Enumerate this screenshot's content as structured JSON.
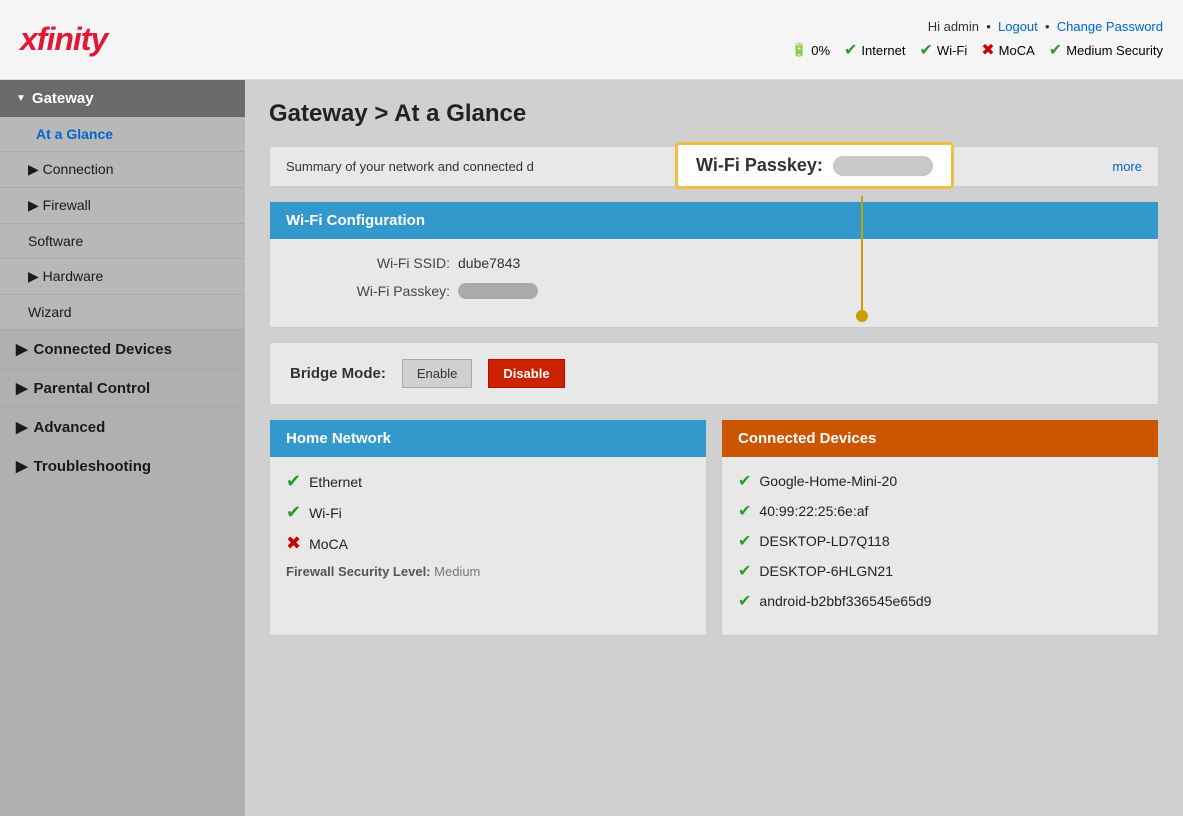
{
  "header": {
    "logo": "xfinity",
    "user_greeting": "Hi admin",
    "logout_label": "Logout",
    "change_password_label": "Change Password",
    "status": {
      "battery": "0%",
      "internet": "Internet",
      "wifi": "Wi-Fi",
      "moca": "MoCA",
      "security": "Medium Security"
    }
  },
  "sidebar": {
    "gateway_label": "Gateway",
    "items": [
      {
        "id": "at-a-glance",
        "label": "At a Glance",
        "active": true,
        "indent": true
      },
      {
        "id": "connection",
        "label": "Connection",
        "active": false,
        "arrow": true
      },
      {
        "id": "firewall",
        "label": "Firewall",
        "active": false,
        "arrow": true
      },
      {
        "id": "software",
        "label": "Software",
        "active": false
      },
      {
        "id": "hardware",
        "label": "Hardware",
        "active": false,
        "arrow": true
      },
      {
        "id": "wizard",
        "label": "Wizard",
        "active": false
      }
    ],
    "groups": [
      {
        "id": "connected-devices",
        "label": "Connected Devices"
      },
      {
        "id": "parental-control",
        "label": "Parental Control"
      },
      {
        "id": "advanced",
        "label": "Advanced"
      },
      {
        "id": "troubleshooting",
        "label": "Troubleshooting"
      }
    ]
  },
  "main": {
    "page_title": "Gateway > At a Glance",
    "summary_text": "Summary of your network and connected d",
    "more_label": "more",
    "tooltip": {
      "label": "Wi-Fi Passkey:"
    },
    "wifi_config": {
      "section_title": "Wi-Fi Configuration",
      "ssid_label": "Wi-Fi SSID:",
      "ssid_value": "dube7843",
      "passkey_label": "Wi-Fi Passkey:"
    },
    "bridge_mode": {
      "label": "Bridge Mode:",
      "enable_label": "Enable",
      "disable_label": "Disable"
    },
    "home_network": {
      "title": "Home Network",
      "items": [
        {
          "label": "Ethernet",
          "status": "ok"
        },
        {
          "label": "Wi-Fi",
          "status": "ok"
        },
        {
          "label": "MoCA",
          "status": "error"
        }
      ],
      "firewall_label": "Firewall Security Level:",
      "firewall_value": "Medium"
    },
    "connected_devices": {
      "title": "Connected Devices",
      "items": [
        {
          "label": "Google-Home-Mini-20",
          "status": "ok"
        },
        {
          "label": "40:99:22:25:6e:af",
          "status": "ok"
        },
        {
          "label": "DESKTOP-LD7Q118",
          "status": "ok"
        },
        {
          "label": "DESKTOP-6HLGN21",
          "status": "ok"
        },
        {
          "label": "android-b2bbf336545e65d9",
          "status": "ok"
        }
      ]
    }
  }
}
